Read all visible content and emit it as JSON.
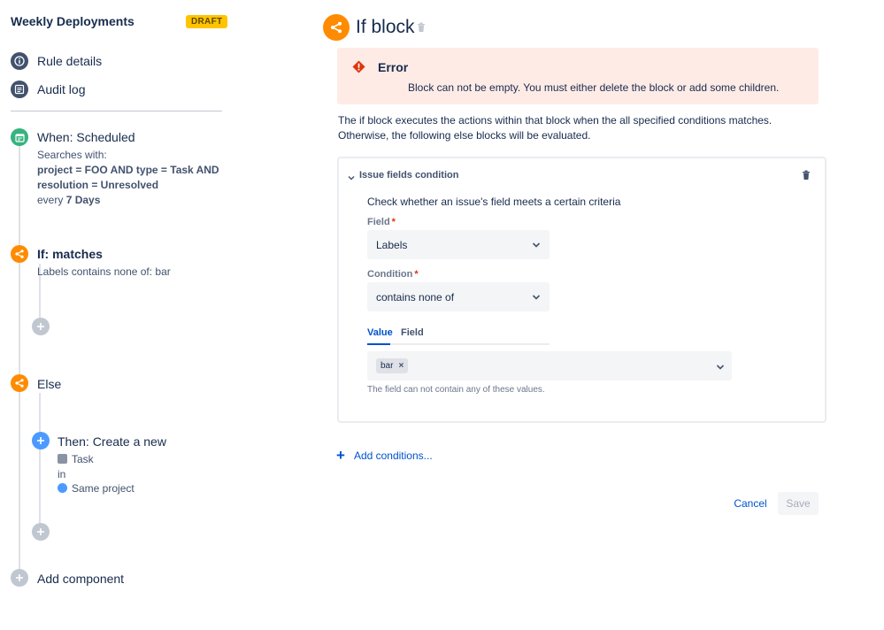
{
  "rule": {
    "title": "Weekly Deployments",
    "status_badge": "DRAFT",
    "nav": [
      {
        "label": "Rule details",
        "icon": "info-icon"
      },
      {
        "label": "Audit log",
        "icon": "list-icon"
      }
    ]
  },
  "components": {
    "trigger": {
      "title": "When: Scheduled",
      "line1": "Searches with:",
      "jql_line1": "project = FOO AND type = Task AND",
      "jql_line2": "resolution = Unresolved",
      "every_prefix": "every",
      "every_value": "7 Days",
      "icon": "calendar-icon"
    },
    "if_branch": {
      "title": "If: matches",
      "summary": "Labels contains none of: bar",
      "icon": "branch-icon"
    },
    "else_branch": {
      "title": "Else",
      "icon": "branch-icon"
    },
    "action": {
      "title": "Then: Create a new",
      "issue_type": "Task",
      "in_label": "in",
      "project": "Same project",
      "icon": "plus-icon"
    },
    "add_component": "Add component"
  },
  "panel": {
    "title": "If block",
    "error": {
      "heading": "Error",
      "message": "Block can not be empty. You must either delete the block or add some children."
    },
    "description": "The if block executes the actions within that block when the all specified conditions matches. Otherwise, the following else blocks will be evaluated.",
    "condition": {
      "title": "Issue fields condition",
      "description": "Check whether an issue's field meets a certain criteria",
      "field_label": "Field",
      "field_value": "Labels",
      "condition_label": "Condition",
      "condition_value": "contains none of",
      "tabs": [
        "Value",
        "Field"
      ],
      "active_tab": "Value",
      "values": [
        "bar"
      ],
      "helper": "The field can not contain any of these values."
    },
    "add_conditions": "Add conditions...",
    "cancel": "Cancel",
    "save": "Save"
  },
  "colors": {
    "trigger": "#36B37E",
    "branch": "#FF8B00",
    "action": "#4C9AFF",
    "link": "#0052CC",
    "error_bg": "#FFEBE6",
    "error_icon": "#DE350B",
    "badge": "#FFC400"
  }
}
